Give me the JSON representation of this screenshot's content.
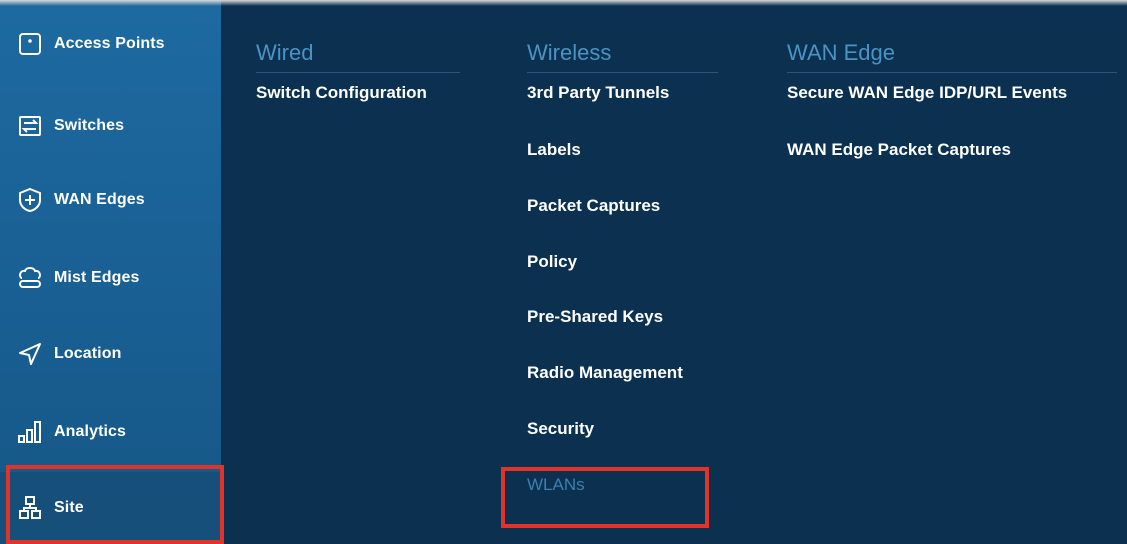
{
  "sidebar": {
    "items": [
      {
        "label": "Access Points",
        "icon": "access-point-icon"
      },
      {
        "label": "Switches",
        "icon": "switch-icon"
      },
      {
        "label": "WAN Edges",
        "icon": "wan-edge-icon"
      },
      {
        "label": "Mist Edges",
        "icon": "mist-edge-icon"
      },
      {
        "label": "Location",
        "icon": "location-icon"
      },
      {
        "label": "Analytics",
        "icon": "analytics-icon"
      },
      {
        "label": "Site",
        "icon": "site-icon",
        "selected": true
      }
    ]
  },
  "menu": {
    "wired": {
      "title": "Wired",
      "items": [
        "Switch Configuration"
      ]
    },
    "wireless": {
      "title": "Wireless",
      "items": [
        "3rd Party Tunnels",
        "Labels",
        "Packet Captures",
        "Policy",
        "Pre-Shared Keys",
        "Radio Management",
        "Security",
        "WLANs"
      ]
    },
    "wan_edge": {
      "title": "WAN Edge",
      "items": [
        "Secure WAN Edge IDP/URL Events",
        "WAN Edge Packet Captures"
      ]
    }
  },
  "colors": {
    "sidebar_bg": "#1d6aa1",
    "panel_bg": "#0b3050",
    "heading": "#4a93c4",
    "highlight": "#e0342a"
  }
}
